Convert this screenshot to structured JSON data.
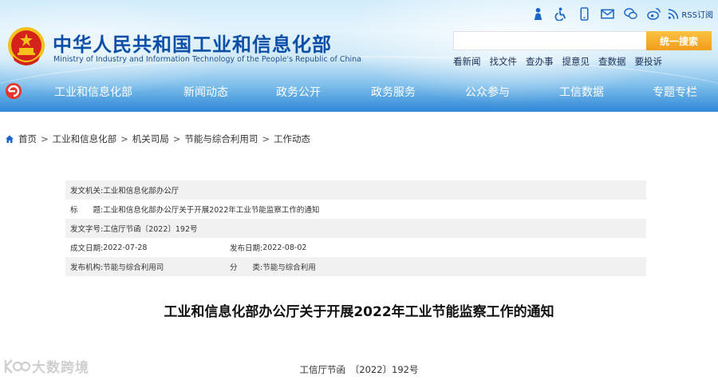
{
  "header": {
    "title_cn": "中华人民共和国工业和信息化部",
    "title_en": "Ministry of Industry and Information Technology of the People's Republic of China",
    "icons": [
      "elderly-mode-icon",
      "accessibility-icon",
      "mobile-icon",
      "mail-icon",
      "wechat-icon",
      "weibo-icon",
      "rss-icon"
    ],
    "rss_label": "RSS订阅",
    "search": {
      "value": "",
      "placeholder": "",
      "button_label": "统一搜索"
    },
    "quick_links": [
      "看新闻",
      "找文件",
      "查办事",
      "提意见",
      "查数据",
      "要投诉"
    ],
    "nav": [
      "工业和信息化部",
      "新闻动态",
      "政务公开",
      "政务服务",
      "公众参与",
      "工信数据",
      "专题专栏"
    ]
  },
  "breadcrumb": [
    "首页",
    "工业和信息化部",
    "机关司局",
    "节能与综合利用司",
    "工作动态"
  ],
  "info": {
    "issuer_label": "发文机关:",
    "issuer": "工业和信息化部办公厅",
    "title_label": "标　　题:",
    "title": "工业和信息化部办公厅关于开展2022年工业节能监察工作的通知",
    "docno_label": "发文字号:",
    "docno": "工信厅节函〔2022〕192号",
    "created_label": "成文日期:",
    "created": "2022-07-28",
    "published_label": "发布日期:",
    "published": "2022-08-02",
    "org_label": "发布机构:",
    "org": "节能与综合利用司",
    "category_label": "分　　类:",
    "category": "节能与综合利用"
  },
  "article": {
    "title": "工业和信息化部办公厅关于开展2022年工业节能监察工作的通知",
    "doc_number": "工信厅节函　〔2022〕192号"
  },
  "watermark": {
    "text": "大数跨境"
  },
  "colors": {
    "title_blue": "#0d4fa8",
    "search_button": "#f29c1c",
    "nav_text": "#ffffff",
    "row_shade": "#f1f1f1"
  }
}
